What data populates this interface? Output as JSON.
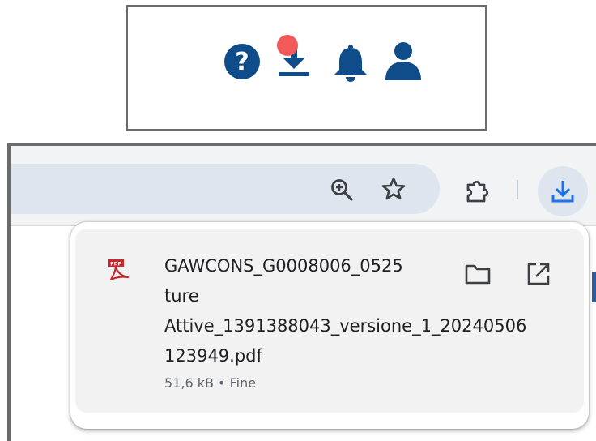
{
  "top_bar": {
    "icons": [
      "help-icon",
      "download-icon",
      "bell-icon",
      "user-icon"
    ],
    "colors": {
      "icon": "#0f4c8a",
      "badge": "#f05a5a"
    }
  },
  "browser": {
    "toolbar_icons": [
      "zoom-icon",
      "star-icon",
      "extensions-icon",
      "download-icon"
    ],
    "colors": {
      "toolbar": "#f1f3f4",
      "omnibox": "#dfe5ee",
      "accent": "#1a73e8"
    }
  },
  "download_item": {
    "file_name_line1": "GAWCONS_G0008006_0525",
    "file_name_line2": "ture",
    "file_name_line3": "Attive_1391388043_versione_1_20240506",
    "file_name_line4": "123949.pdf",
    "size": "51,6 kB",
    "separator": "•",
    "status": "Fine",
    "file_icon": "pdf-icon",
    "actions": [
      "folder-icon",
      "open-external-icon"
    ]
  }
}
